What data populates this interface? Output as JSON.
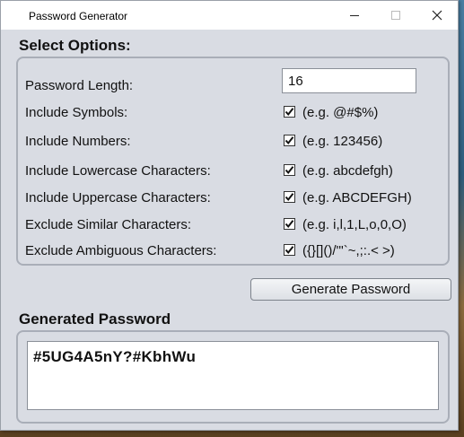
{
  "window": {
    "title": "Password Generator"
  },
  "options": {
    "heading": "Select Options:",
    "length": {
      "label": "Password Length:",
      "value": "16"
    },
    "items": [
      {
        "label": "Include Symbols:",
        "checked": true,
        "example": "(e.g. @#$%)"
      },
      {
        "label": "Include Numbers:",
        "checked": true,
        "example": "(e.g. 123456)"
      },
      {
        "label": "Include Lowercase Characters:",
        "checked": true,
        "example": "(e.g. abcdefgh)"
      },
      {
        "label": "Include Uppercase Characters:",
        "checked": true,
        "example": "(e.g. ABCDEFGH)"
      },
      {
        "label": "Exclude Similar Characters:",
        "checked": true,
        "example": "(e.g. i,l,1,L,o,0,O)"
      },
      {
        "label": "Exclude Ambiguous Characters:",
        "checked": true,
        "example": "({}[]()/'\"`~,;:.< >)"
      }
    ]
  },
  "actions": {
    "generate_label": "Generate Password"
  },
  "result": {
    "heading": "Generated Password",
    "password": "#5UG4A5nY?#KbhWu"
  }
}
